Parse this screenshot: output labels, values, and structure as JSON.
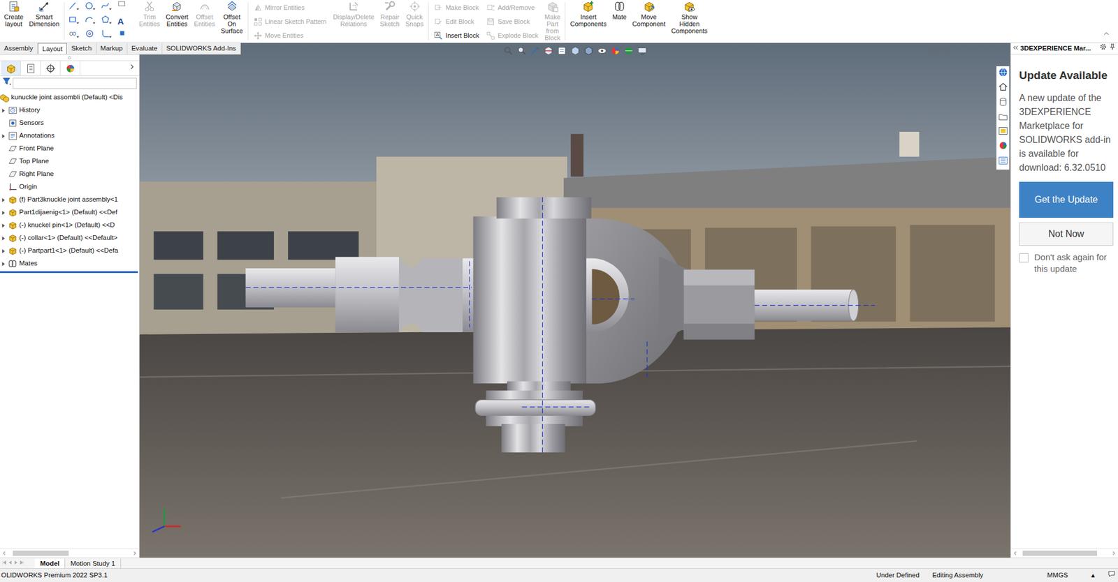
{
  "ribbon": {
    "items": [
      {
        "kind": "large",
        "lines": [
          "Create",
          "layout"
        ],
        "disabled": false
      },
      {
        "kind": "large",
        "lines": [
          "Smart",
          "Dimension"
        ],
        "disabled": false
      },
      {
        "kind": "tools",
        "glyph": "A"
      },
      {
        "kind": "large",
        "lines": [
          "Trim",
          "Entities"
        ],
        "disabled": true
      },
      {
        "kind": "large",
        "lines": [
          "Convert",
          "Entities"
        ],
        "disabled": false
      },
      {
        "kind": "large",
        "lines": [
          "Offset",
          "Entities"
        ],
        "disabled": true
      },
      {
        "kind": "large",
        "lines": [
          "Offset",
          "On",
          "Surface"
        ],
        "disabled": false
      },
      {
        "kind": "stack",
        "entries": [
          {
            "label": "Mirror Entities",
            "disabled": true
          },
          {
            "label": "Linear Sketch Pattern",
            "disabled": true
          },
          {
            "label": "Move Entities",
            "disabled": true
          }
        ]
      },
      {
        "kind": "large",
        "lines": [
          "Display/Delete",
          "Relations"
        ],
        "disabled": true
      },
      {
        "kind": "large",
        "lines": [
          "Repair",
          "Sketch"
        ],
        "disabled": true
      },
      {
        "kind": "large",
        "lines": [
          "Quick",
          "Snaps"
        ],
        "disabled": true
      },
      {
        "kind": "stack",
        "entries": [
          {
            "label": "Make Block",
            "disabled": true
          },
          {
            "label": "Edit Block",
            "disabled": true
          },
          {
            "label": "Insert Block",
            "disabled": false
          }
        ]
      },
      {
        "kind": "stack",
        "entries": [
          {
            "label": "Add/Remove",
            "disabled": true
          },
          {
            "label": "Save Block",
            "disabled": true
          },
          {
            "label": "Explode Block",
            "disabled": true
          }
        ]
      },
      {
        "kind": "large",
        "lines": [
          "Make",
          "Part",
          "from",
          "Block"
        ],
        "disabled": true
      },
      {
        "kind": "large",
        "lines": [
          "Insert",
          "Components"
        ],
        "disabled": false
      },
      {
        "kind": "large",
        "lines": [
          "Mate"
        ],
        "disabled": false
      },
      {
        "kind": "large",
        "lines": [
          "Move",
          "Component"
        ],
        "disabled": false
      },
      {
        "kind": "large",
        "lines": [
          "Show",
          "Hidden",
          "Components"
        ],
        "disabled": false
      }
    ]
  },
  "tabs": [
    {
      "label": "Assembly",
      "selected": false
    },
    {
      "label": "Layout",
      "selected": true
    },
    {
      "label": "Sketch",
      "selected": false
    },
    {
      "label": "Markup",
      "selected": false
    },
    {
      "label": "Evaluate",
      "selected": false
    },
    {
      "label": "SOLIDWORKS Add-Ins",
      "selected": false
    }
  ],
  "feature_tree": {
    "root": "kunuckle joint assombli (Default) <Dis",
    "items": [
      {
        "label": "History",
        "kind": "history",
        "expanded": false
      },
      {
        "label": "Sensors",
        "kind": "sensors"
      },
      {
        "label": "Annotations",
        "kind": "annotations",
        "expanded": false
      },
      {
        "label": "Front Plane",
        "kind": "plane"
      },
      {
        "label": "Top Plane",
        "kind": "plane"
      },
      {
        "label": "Right Plane",
        "kind": "plane"
      },
      {
        "label": "Origin",
        "kind": "origin"
      },
      {
        "label": "(f) Part3knuckle joint assembly<1",
        "kind": "part",
        "expanded": false
      },
      {
        "label": "Part1dijaenig<1> (Default) <<Def",
        "kind": "part",
        "expanded": false
      },
      {
        "label": "(-) knuckel pin<1> (Default) <<D",
        "kind": "part",
        "expanded": false
      },
      {
        "label": "(-) collar<1> (Default) <<Default>",
        "kind": "part",
        "expanded": false
      },
      {
        "label": "(-) Partpart1<1> (Default) <<Defa",
        "kind": "part",
        "expanded": false
      },
      {
        "label": "Mates",
        "kind": "mates",
        "expanded": false
      }
    ]
  },
  "task_pane": {
    "title": "3DEXPERIENCE Mar...",
    "heading": "Update Available",
    "message": "A new update of the 3DEXPERIENCE Marketplace for SOLIDWORKS add-in is available for download: 6.32.0510",
    "primary_button": "Get the Update",
    "secondary_button": "Not Now",
    "checkbox": {
      "label": "Don't ask again for this update",
      "checked": false
    }
  },
  "bottom_tabs": [
    {
      "label": "Model",
      "selected": true
    },
    {
      "label": "Motion Study 1",
      "selected": false
    }
  ],
  "status_bar": {
    "product": "OLIDWORKS Premium 2022 SP3.1",
    "fields": [
      "Under Defined",
      "Editing Assembly"
    ],
    "units": "MMGS",
    "units_caret": "▴"
  }
}
